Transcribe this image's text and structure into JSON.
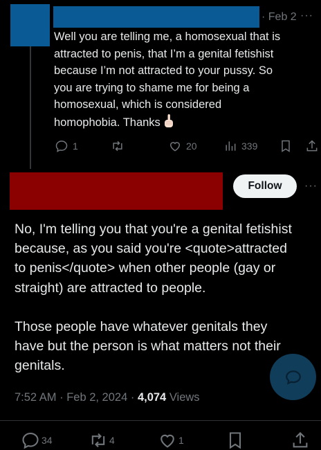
{
  "reply": {
    "date": "Feb 2",
    "text": "Well you are telling me, a homosexual that is\nattracted to penis, that I’m a genital fetishist\nbecause I’m not attracted to your pussy. So\nyou are trying to shame me for being a\nhomosexual, which is considered\nhomophobia. Thanks",
    "actions": {
      "replies": "1",
      "reposts": "",
      "likes": "20",
      "views": "339"
    }
  },
  "main": {
    "follow_label": "Follow",
    "text": "No, I'm telling you that you're a genital fetishist\nbecause, as you said you're <quote>attracted\nto penis</quote> when other people (gay or\nstraight) are attracted to people.\n\nThose people have whatever genitals they\nhave but the person is what matters not their\ngenitals.",
    "time": "7:52 AM · Feb 2, 2024 · ",
    "views_count": "4,074",
    "views_label": " Views",
    "bottom_actions": {
      "replies": "34",
      "reposts": "4",
      "likes": "1"
    }
  },
  "icons": [
    "more-icon",
    "reply-icon",
    "repost-icon",
    "like-icon",
    "views-icon",
    "bookmark-icon",
    "share-icon",
    "middle-finger-emoji",
    "chat-icon"
  ],
  "colors": {
    "background": "#000000",
    "text": "#e7e9ea",
    "muted": "#71767b",
    "redaction_blue": "#0a5a96",
    "redaction_red": "#8b0000"
  }
}
